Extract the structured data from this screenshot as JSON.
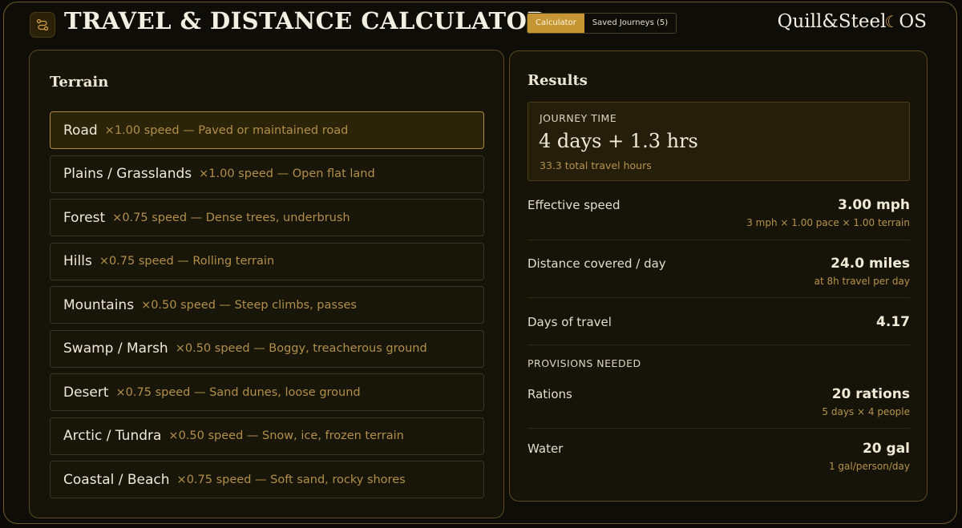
{
  "header": {
    "title": "TRAVEL & DISTANCE CALCULATOR",
    "tabs": [
      {
        "label": "Calculator",
        "active": true
      },
      {
        "label": "Saved Journeys (5)",
        "active": false
      }
    ],
    "brand": "Quill&Steel",
    "brand_suffix": "OS"
  },
  "terrain": {
    "heading": "Terrain",
    "items": [
      {
        "name": "Road",
        "desc": "×1.00 speed — Paved or maintained road",
        "selected": true
      },
      {
        "name": "Plains / Grasslands",
        "desc": "×1.00 speed — Open flat land",
        "selected": false
      },
      {
        "name": "Forest",
        "desc": "×0.75 speed — Dense trees, underbrush",
        "selected": false
      },
      {
        "name": "Hills",
        "desc": "×0.75 speed — Rolling terrain",
        "selected": false
      },
      {
        "name": "Mountains",
        "desc": "×0.50 speed — Steep climbs, passes",
        "selected": false
      },
      {
        "name": "Swamp / Marsh",
        "desc": "×0.50 speed — Boggy, treacherous ground",
        "selected": false
      },
      {
        "name": "Desert",
        "desc": "×0.75 speed — Sand dunes, loose ground",
        "selected": false
      },
      {
        "name": "Arctic / Tundra",
        "desc": "×0.50 speed — Snow, ice, frozen terrain",
        "selected": false
      },
      {
        "name": "Coastal / Beach",
        "desc": "×0.75 speed — Soft sand, rocky shores",
        "selected": false
      }
    ]
  },
  "results": {
    "heading": "Results",
    "journey_time": {
      "label": "JOURNEY TIME",
      "value": "4 days + 1.3 hrs",
      "sub": "33.3 total travel hours"
    },
    "effective_speed": {
      "label": "Effective speed",
      "value": "3.00 mph",
      "sub": "3 mph × 1.00 pace × 1.00 terrain"
    },
    "distance_per_day": {
      "label": "Distance covered / day",
      "value": "24.0 miles",
      "sub": "at 8h travel per day"
    },
    "days_of_travel": {
      "label": "Days of travel",
      "value": "4.17"
    },
    "provisions_label": "PROVISIONS NEEDED",
    "rations": {
      "label": "Rations",
      "value": "20 rations",
      "sub": "5 days × 4 people"
    },
    "water": {
      "label": "Water",
      "value": "20 gal",
      "sub": "1 gal/person/day"
    }
  },
  "colors": {
    "accent": "#c79634",
    "panel_border": "#5a4a1e",
    "muted_gold": "#b38e48"
  },
  "icons": {
    "app": "route-icon",
    "brand": "crescent-moon-icon"
  }
}
